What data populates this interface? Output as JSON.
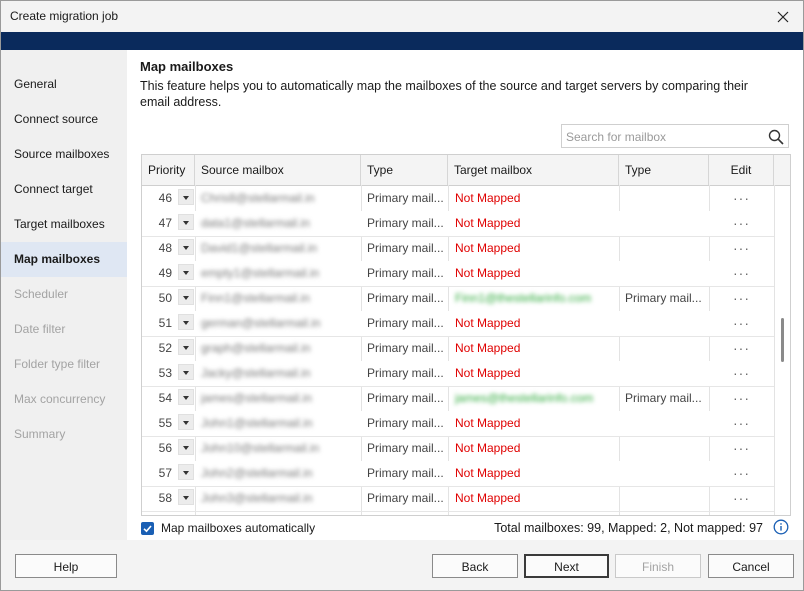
{
  "window": {
    "title": "Create migration job"
  },
  "sidebar": {
    "items": [
      {
        "label": "General",
        "state": "normal"
      },
      {
        "label": "Connect source",
        "state": "normal"
      },
      {
        "label": "Source mailboxes",
        "state": "normal"
      },
      {
        "label": "Connect target",
        "state": "normal"
      },
      {
        "label": "Target mailboxes",
        "state": "normal"
      },
      {
        "label": "Map mailboxes",
        "state": "active"
      },
      {
        "label": "Scheduler",
        "state": "disabled"
      },
      {
        "label": "Date filter",
        "state": "disabled"
      },
      {
        "label": "Folder type filter",
        "state": "disabled"
      },
      {
        "label": "Max concurrency",
        "state": "disabled"
      },
      {
        "label": "Summary",
        "state": "disabled"
      }
    ]
  },
  "main": {
    "heading": "Map mailboxes",
    "description": "This feature helps you to automatically map the mailboxes of the source and target servers by comparing their email address.",
    "search": {
      "placeholder": "Search for mailbox",
      "value": ""
    },
    "table": {
      "columns": [
        "Priority",
        "Source mailbox",
        "Type",
        "Target mailbox",
        "Type",
        "Edit"
      ],
      "rows": [
        {
          "priority": "46",
          "source": "Chris8@stellarmail.in",
          "type": "Primary mail...",
          "target": "Not Mapped",
          "mapped": false,
          "target_type": "",
          "edit": "···"
        },
        {
          "priority": "47",
          "source": "data1@stellarmail.in",
          "type": "Primary mail...",
          "target": "Not Mapped",
          "mapped": false,
          "target_type": "",
          "edit": "···"
        },
        {
          "priority": "48",
          "source": "David1@stellarmail.in",
          "type": "Primary mail...",
          "target": "Not Mapped",
          "mapped": false,
          "target_type": "",
          "edit": "···"
        },
        {
          "priority": "49",
          "source": "empty1@stellarmail.in",
          "type": "Primary mail...",
          "target": "Not Mapped",
          "mapped": false,
          "target_type": "",
          "edit": "···"
        },
        {
          "priority": "50",
          "source": "Finn1@stellarmail.in",
          "type": "Primary mail...",
          "target": "Finn1@thestellarinfo.com",
          "mapped": true,
          "target_type": "Primary mail...",
          "edit": "···"
        },
        {
          "priority": "51",
          "source": "german@stellarmail.in",
          "type": "Primary mail...",
          "target": "Not Mapped",
          "mapped": false,
          "target_type": "",
          "edit": "···"
        },
        {
          "priority": "52",
          "source": "graph@stellarmail.in",
          "type": "Primary mail...",
          "target": "Not Mapped",
          "mapped": false,
          "target_type": "",
          "edit": "···"
        },
        {
          "priority": "53",
          "source": "Jacky@stellarmail.in",
          "type": "Primary mail...",
          "target": "Not Mapped",
          "mapped": false,
          "target_type": "",
          "edit": "···"
        },
        {
          "priority": "54",
          "source": "james@stellarmail.in",
          "type": "Primary mail...",
          "target": "james@thestellarinfo.com",
          "mapped": true,
          "target_type": "Primary mail...",
          "edit": "···"
        },
        {
          "priority": "55",
          "source": "John1@stellarmail.in",
          "type": "Primary mail...",
          "target": "Not Mapped",
          "mapped": false,
          "target_type": "",
          "edit": "···"
        },
        {
          "priority": "56",
          "source": "John10@stellarmail.in",
          "type": "Primary mail...",
          "target": "Not Mapped",
          "mapped": false,
          "target_type": "",
          "edit": "···"
        },
        {
          "priority": "57",
          "source": "John2@stellarmail.in",
          "type": "Primary mail...",
          "target": "Not Mapped",
          "mapped": false,
          "target_type": "",
          "edit": "···"
        },
        {
          "priority": "58",
          "source": "John3@stellarmail.in",
          "type": "Primary mail...",
          "target": "Not Mapped",
          "mapped": false,
          "target_type": "",
          "edit": "···"
        }
      ]
    },
    "auto_map": {
      "label": "Map mailboxes automatically",
      "checked": true
    },
    "totals": "Total mailboxes: 99, Mapped: 2, Not mapped: 97"
  },
  "footer": {
    "help": "Help",
    "back": "Back",
    "next": "Next",
    "finish": "Finish",
    "cancel": "Cancel"
  },
  "colors": {
    "banner": "#0a2a5c",
    "not_mapped": "#e00000",
    "mapped_target": "#2faa3c",
    "checkbox": "#1a5fb4",
    "active_nav": "#dfe7f3"
  }
}
